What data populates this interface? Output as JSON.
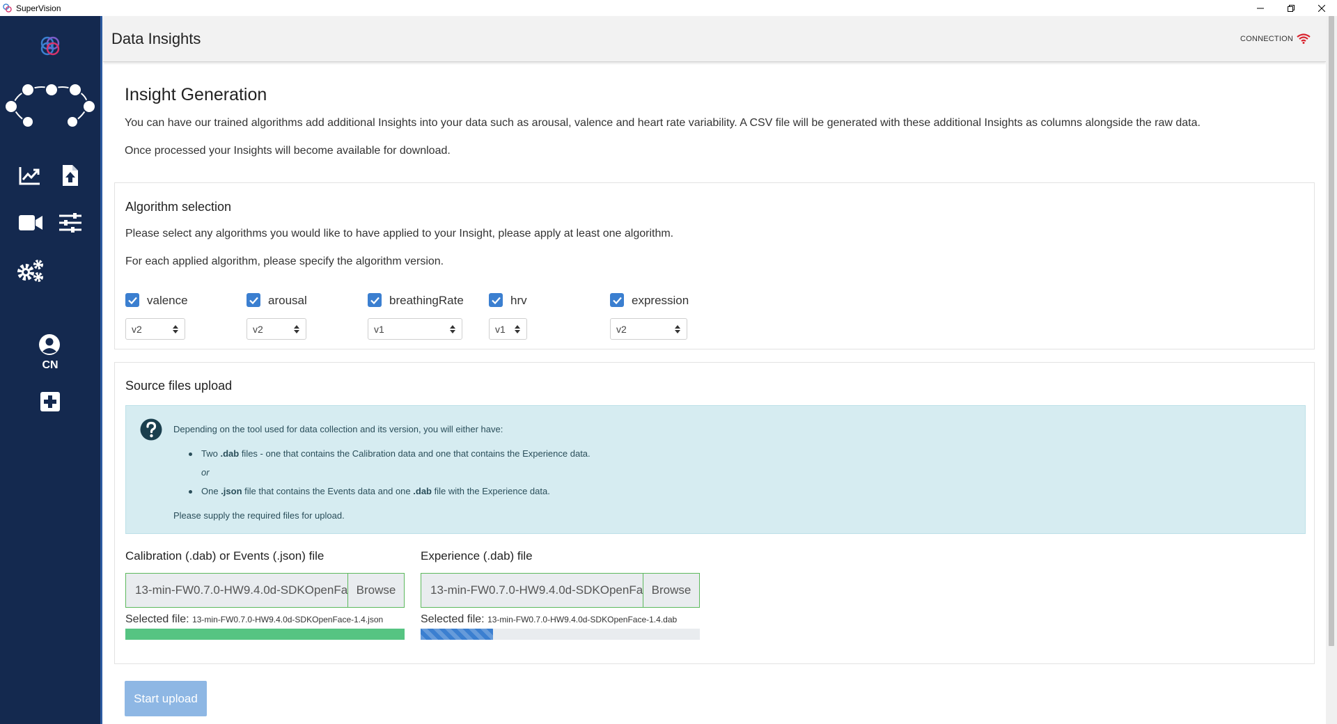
{
  "window": {
    "title": "SuperVision"
  },
  "header": {
    "title": "Data Insights",
    "connection_label": "CONNECTION"
  },
  "sidebar": {
    "user_initials": "CN"
  },
  "intro": {
    "heading": "Insight Generation",
    "paragraph1": "You can have our trained algorithms add additional Insights into your data such as arousal, valence and heart rate variability. A CSV file will be generated with these additional Insights as columns alongside the raw data.",
    "paragraph2": "Once processed your Insights will become available for download."
  },
  "algorithm_selection": {
    "title": "Algorithm selection",
    "desc1": "Please select any algorithms you would like to have applied to your Insight, please apply at least one algorithm.",
    "desc2": "For each applied algorithm, please specify the algorithm version.",
    "algorithms": [
      {
        "name": "valence",
        "checked": true,
        "version": "v2"
      },
      {
        "name": "arousal",
        "checked": true,
        "version": "v2"
      },
      {
        "name": "breathingRate",
        "checked": true,
        "version": "v1"
      },
      {
        "name": "hrv",
        "checked": true,
        "version": "v1"
      },
      {
        "name": "expression",
        "checked": true,
        "version": "v2"
      }
    ]
  },
  "source_upload": {
    "title": "Source files upload",
    "info": {
      "line1": "Depending on the tool used for data collection and its version, you will either have:",
      "bullet1_pre": "Two ",
      "bullet1_bold": ".dab",
      "bullet1_post": " files - one that contains the Calibration data and one that contains the Experience data.",
      "or": "or",
      "bullet2_pre": "One ",
      "bullet2_bold1": ".json",
      "bullet2_mid": " file that contains the Events data and one ",
      "bullet2_bold2": ".dab",
      "bullet2_post": " file with the Experience data.",
      "footer": "Please supply the required files for upload."
    },
    "calibration": {
      "label": "Calibration (.dab) or Events (.json) file",
      "value": "13-min-FW0.7.0-HW9.4.0d-SDKOpenFace-1.4.json",
      "browse": "Browse",
      "selected_label": "Selected file:",
      "selected_file": "13-min-FW0.7.0-HW9.4.0d-SDKOpenFace-1.4.json",
      "progress": 1.0
    },
    "experience": {
      "label": "Experience (.dab) file",
      "value": "13-min-FW0.7.0-HW9.4.0d-SDKOpenFace-1.4.dab",
      "browse": "Browse",
      "selected_label": "Selected file:",
      "selected_file": "13-min-FW0.7.0-HW9.4.0d-SDKOpenFace-1.4.dab",
      "progress": 0.26
    }
  },
  "actions": {
    "start_upload": "Start upload"
  },
  "colors": {
    "sidebar": "#14294f",
    "accent": "#3b7fd0",
    "success": "#5cb85c",
    "info_bg": "#d6ecf1",
    "connection": "#d9232e"
  }
}
